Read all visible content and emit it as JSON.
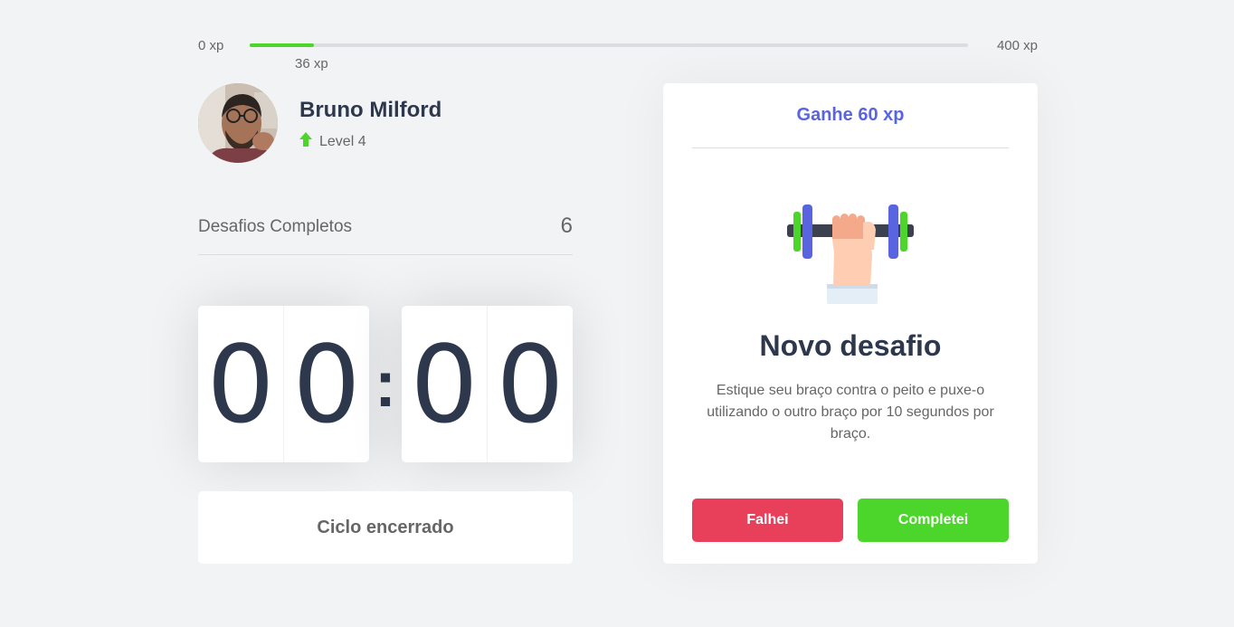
{
  "xp": {
    "min_label": "0 xp",
    "max_label": "400 xp",
    "current_label": "36 xp",
    "progress_fraction": 0.09,
    "fill_color": "#4cd62b"
  },
  "profile": {
    "name": "Bruno Milford",
    "level_label": "Level 4",
    "level_icon": "arrow-up-icon"
  },
  "completed": {
    "label": "Desafios Completos",
    "value": "6"
  },
  "countdown": {
    "minute_left": "0",
    "minute_right": "0",
    "separator": ":",
    "second_left": "0",
    "second_right": "0"
  },
  "cycle_button": {
    "label": "Ciclo encerrado"
  },
  "challenge": {
    "header": "Ganhe 60 xp",
    "icon": "dumbbell-icon",
    "title": "Novo desafio",
    "description": "Estique seu braço contra o peito e puxe-o utilizando o outro braço por 10 segundos por braço.",
    "fail_label": "Falhei",
    "success_label": "Completei"
  },
  "colors": {
    "background": "#f2f3f5",
    "title": "#2e384d",
    "text": "#666666",
    "blue": "#5965e0",
    "red": "#e83f5b",
    "green": "#4cd62b"
  }
}
